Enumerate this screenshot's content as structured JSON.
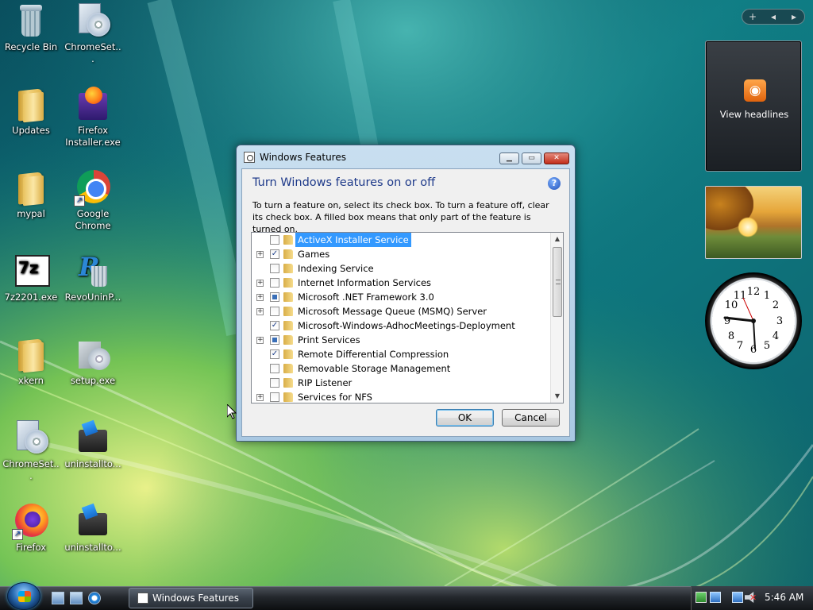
{
  "desktop": {
    "icons": [
      {
        "label": "Recycle Bin",
        "icon": "recycle-bin-icon"
      },
      {
        "label": "ChromeSet...",
        "icon": "setup-disc-icon"
      },
      {
        "label": "Updates",
        "icon": "folder-icon"
      },
      {
        "label": "Firefox Installer.exe",
        "icon": "firefox-installer-icon"
      },
      {
        "label": "mypal",
        "icon": "folder-icon"
      },
      {
        "label": "Google Chrome",
        "icon": "chrome-icon"
      },
      {
        "label": "7z2201.exe",
        "icon": "7zip-icon"
      },
      {
        "label": "RevoUninP...",
        "icon": "revo-uninstaller-icon"
      },
      {
        "label": "xkern",
        "icon": "folder-icon"
      },
      {
        "label": "setup.exe",
        "icon": "setup-disc-icon"
      },
      {
        "label": "ChromeSet...",
        "icon": "setup-disc-icon"
      },
      {
        "label": "uninstallto...",
        "icon": "uninstall-tool-icon"
      },
      {
        "label": "Firefox",
        "icon": "firefox-icon"
      },
      {
        "label": "uninstallto...",
        "icon": "uninstall-tool-icon"
      }
    ]
  },
  "sidebar": {
    "controls": [
      "+",
      "◂",
      "▸"
    ],
    "feed_label": "View headlines",
    "clock_numbers": [
      "12",
      "1",
      "2",
      "3",
      "4",
      "5",
      "6",
      "7",
      "8",
      "9",
      "10",
      "11"
    ]
  },
  "dialog": {
    "title": "Windows Features",
    "heading": "Turn Windows features on or off",
    "description": "To turn a feature on, select its check box. To turn a feature off, clear its check box. A filled box means that only part of the feature is turned on.",
    "help_glyph": "?",
    "features": [
      {
        "name": "ActiveX Installer Service",
        "state": "unchecked",
        "expandable": false,
        "selected": true
      },
      {
        "name": "Games",
        "state": "checked",
        "expandable": true,
        "selected": false
      },
      {
        "name": "Indexing Service",
        "state": "unchecked",
        "expandable": false,
        "selected": false
      },
      {
        "name": "Internet Information Services",
        "state": "unchecked",
        "expandable": true,
        "selected": false
      },
      {
        "name": "Microsoft .NET Framework 3.0",
        "state": "partial",
        "expandable": true,
        "selected": false
      },
      {
        "name": "Microsoft Message Queue (MSMQ) Server",
        "state": "unchecked",
        "expandable": true,
        "selected": false
      },
      {
        "name": "Microsoft-Windows-AdhocMeetings-Deployment",
        "state": "checked",
        "expandable": false,
        "selected": false
      },
      {
        "name": "Print Services",
        "state": "partial",
        "expandable": true,
        "selected": false
      },
      {
        "name": "Remote Differential Compression",
        "state": "checked",
        "expandable": false,
        "selected": false
      },
      {
        "name": "Removable Storage Management",
        "state": "unchecked",
        "expandable": false,
        "selected": false
      },
      {
        "name": "RIP Listener",
        "state": "unchecked",
        "expandable": false,
        "selected": false
      },
      {
        "name": "Services for NFS",
        "state": "unchecked",
        "expandable": true,
        "selected": false
      }
    ],
    "ok_label": "OK",
    "cancel_label": "Cancel"
  },
  "taskbar": {
    "task_label": "Windows Features",
    "clock": "5:46 AM"
  },
  "colors": {
    "heading": "#1e3a8a",
    "selection": "#3399ff",
    "close_button": "#c22e1a"
  }
}
